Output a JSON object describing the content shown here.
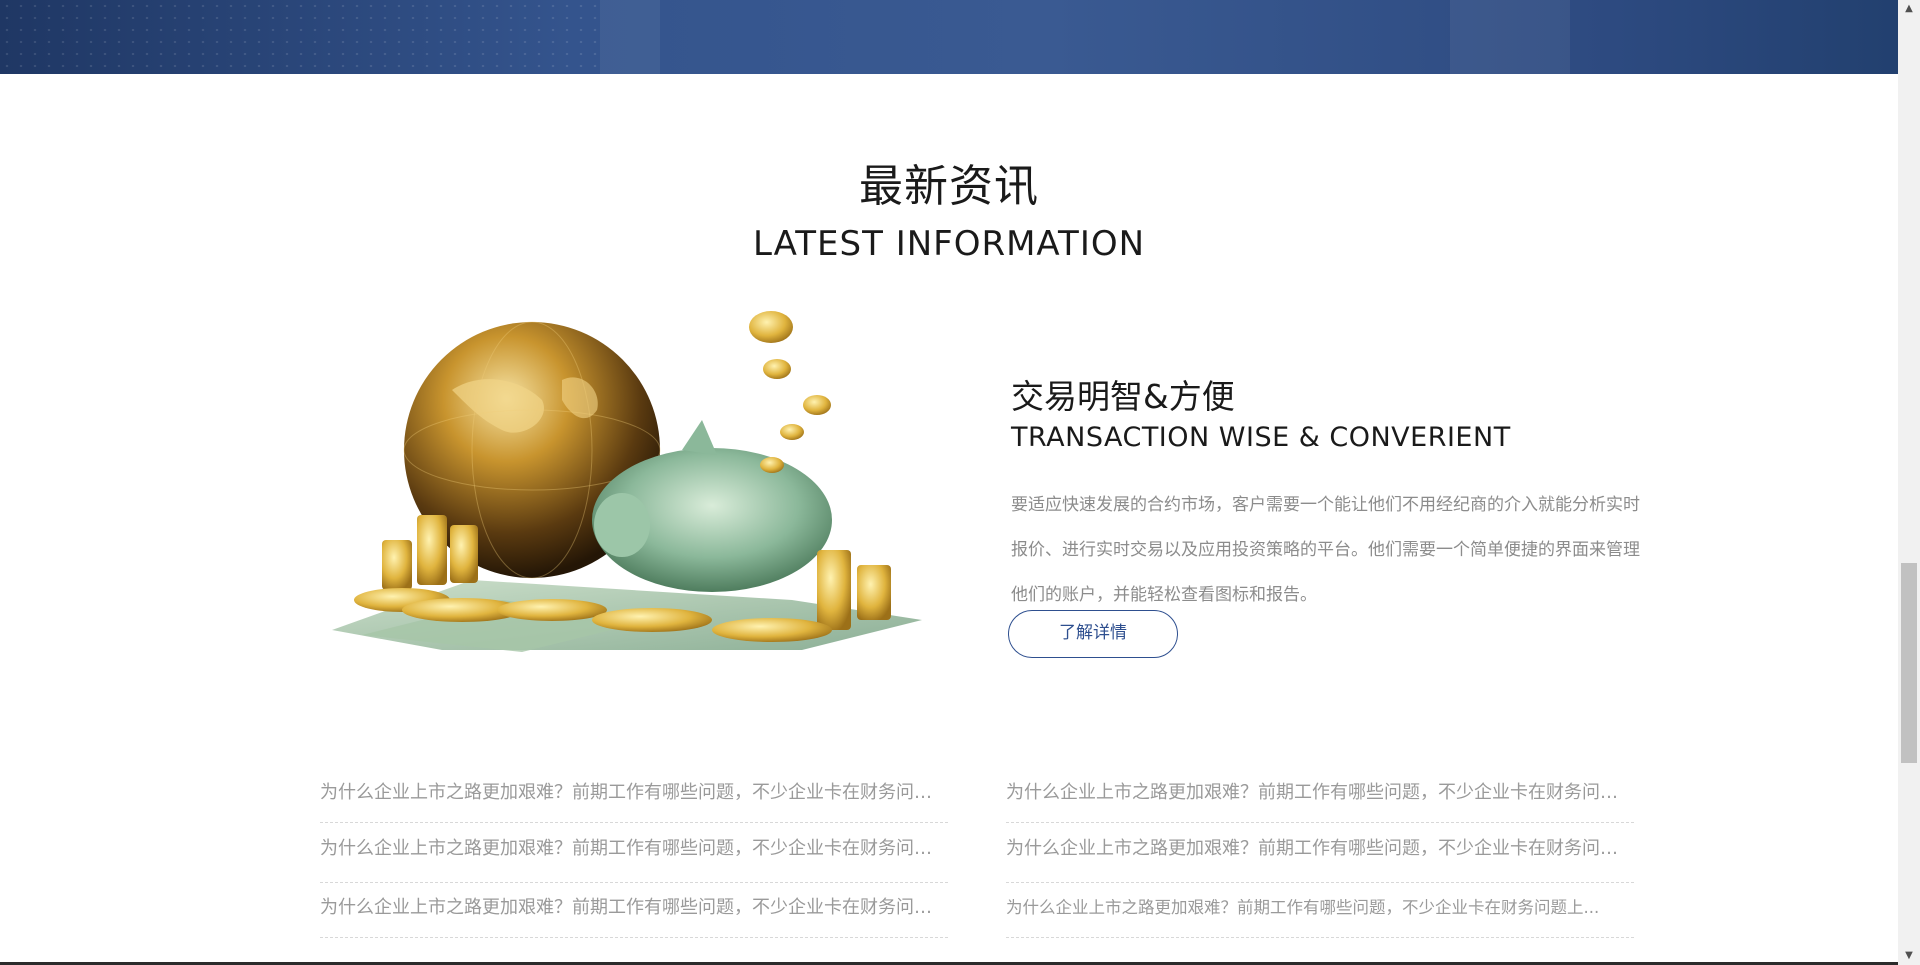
{
  "section": {
    "title": "最新资讯",
    "subtitle": "LATEST INFORMATION"
  },
  "feature": {
    "title": "交易明智&方便",
    "subtitle": "TRANSACTION WISE & CONVERIENT",
    "description": "要适应快速发展的合约市场，客户需要一个能让他们不用经纪商的介入就能分析实时报价、进行实时交易以及应用投资策略的平台。他们需要一个简单便捷的界面来管理他们的账户，并能轻松查看图标和报告。",
    "button_label": "了解详情",
    "image_icon": "globe-coins-piggybank-illustration"
  },
  "news": {
    "left": [
      "为什么企业上市之路更加艰难？前期工作有哪些问题，不少企业卡在财务问题上...",
      "为什么企业上市之路更加艰难？前期工作有哪些问题，不少企业卡在财务问题上...",
      "为什么企业上市之路更加艰难？前期工作有哪些问题，不少企业卡在财务问题上..."
    ],
    "right": [
      "为什么企业上市之路更加艰难？前期工作有哪些问题，不少企业卡在财务问题上...",
      "为什么企业上市之路更加艰难？前期工作有哪些问题，不少企业卡在财务问题上...",
      "为什么企业上市之路更加艰难？前期工作有哪些问题，不少企业卡在财务问题上..."
    ]
  },
  "colors": {
    "accent": "#2e4f8f",
    "banner": "#34548d",
    "muted_text": "#9a9a9a"
  }
}
